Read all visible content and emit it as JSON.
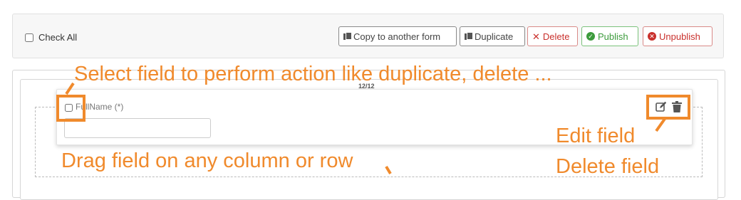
{
  "toolbar": {
    "check_all_label": "Check All",
    "buttons": {
      "copy": "Copy to another form",
      "duplicate": "Duplicate",
      "delete": "Delete",
      "publish": "Publish",
      "unpublish": "Unpublish"
    }
  },
  "form_builder": {
    "column_width": "12/12",
    "field": {
      "label": "FullName (*)",
      "value": ""
    }
  },
  "annotations": {
    "select_field": "Select field to perform action like duplicate, delete ...",
    "drag_field": "Drag field on any column or row",
    "edit_field": "Edit field",
    "delete_field": "Delete field"
  },
  "colors": {
    "annotation": "#f08a2c",
    "danger": "#c9302c",
    "success": "#3c9b3c"
  }
}
